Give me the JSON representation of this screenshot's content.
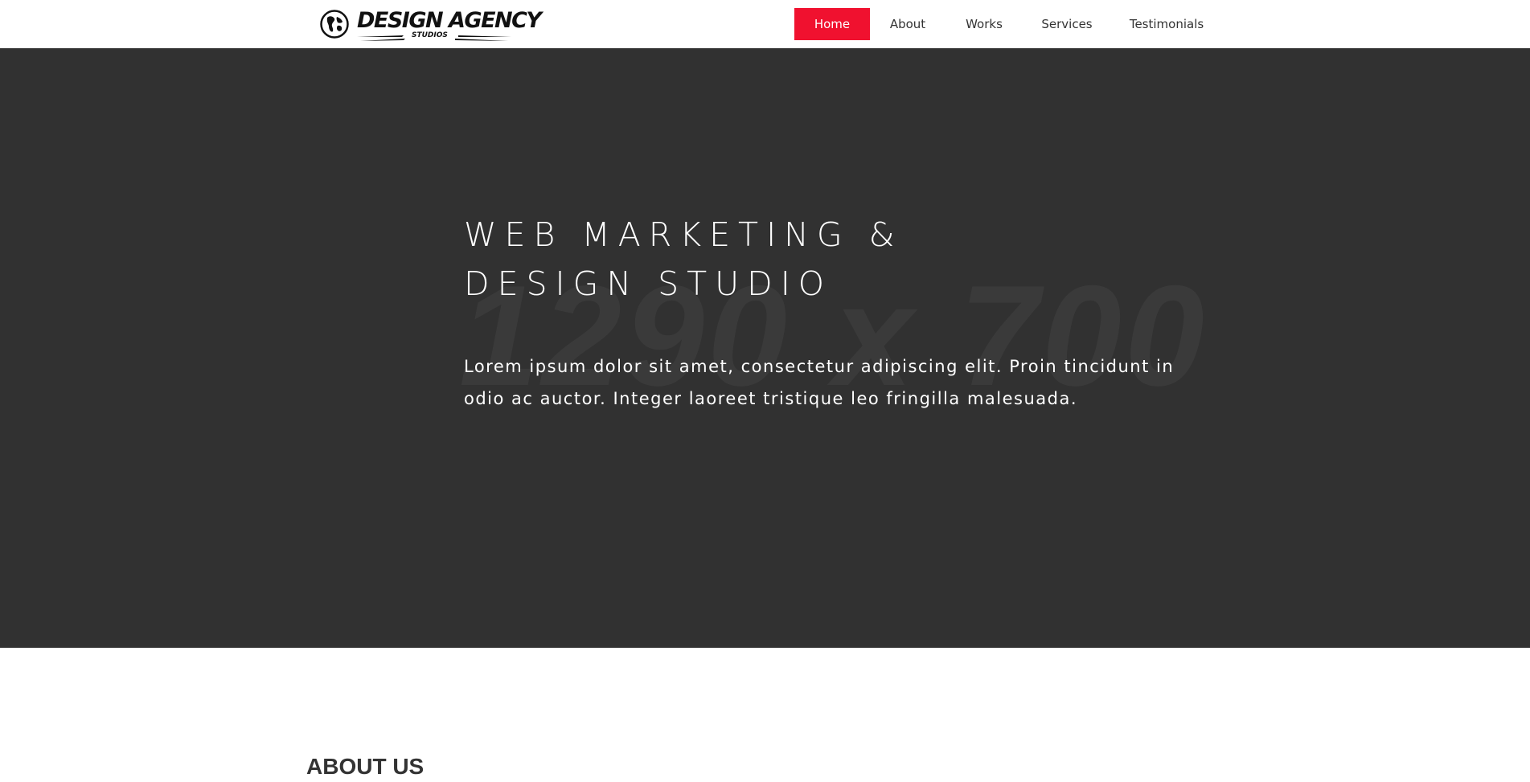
{
  "header": {
    "logo": {
      "title": "DESIGN AGENCY",
      "subtitle": "STUDIOS",
      "icon": "globe-icon"
    },
    "nav": [
      {
        "label": "Home",
        "active": true
      },
      {
        "label": "About",
        "active": false
      },
      {
        "label": "Works",
        "active": false
      },
      {
        "label": "Services",
        "active": false
      },
      {
        "label": "Testimonials",
        "active": false
      }
    ]
  },
  "hero": {
    "placeholder": "1290 x 700",
    "title_line1": "WEB MARKETING &",
    "title_line2": "DESIGN STUDIO",
    "text": "Lorem ipsum dolor sit amet, consectetur adipiscing elit. Proin tincidunt in odio ac auctor. Integer laoreet tristique leo fringilla malesuada."
  },
  "about": {
    "title": "ABOUT US"
  },
  "colors": {
    "accent": "#f0112f",
    "hero_background": "#313131",
    "header_background": "#ffffff",
    "text_dark": "#333333"
  }
}
